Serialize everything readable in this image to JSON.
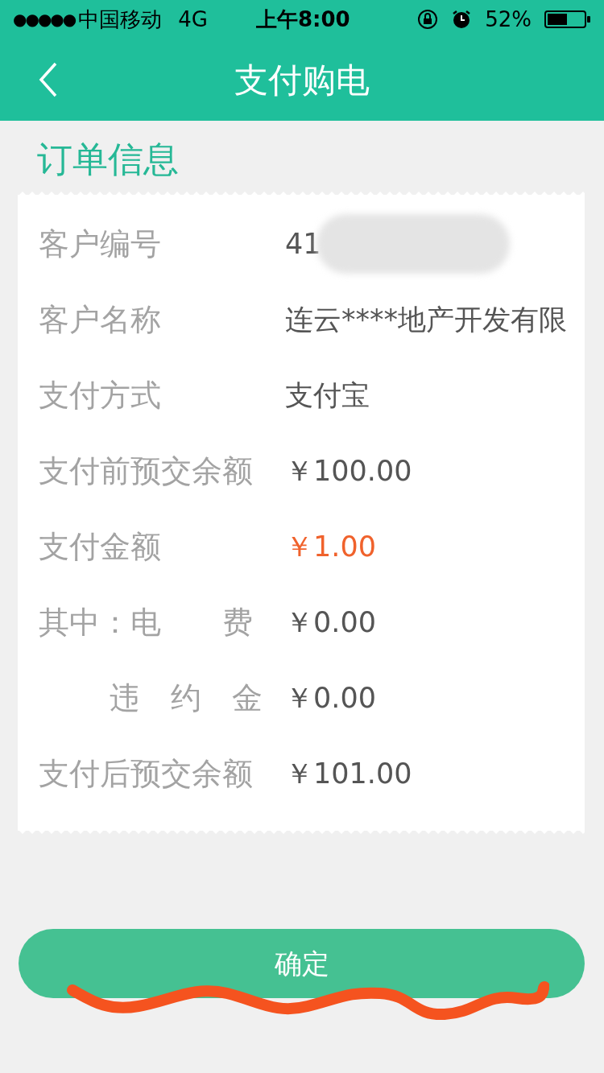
{
  "status_bar": {
    "signal": "●●●●●",
    "carrier": "中国移动",
    "network": "4G",
    "time": "上午8:00",
    "battery_percent": "52%"
  },
  "nav_bar": {
    "title": "支付购电"
  },
  "section_title": "订单信息",
  "rows": [
    {
      "kind": "main",
      "label": "客户编号",
      "value": "41",
      "redacted": true
    },
    {
      "kind": "main",
      "label": "客户名称",
      "value": "连云****地产开发有限"
    },
    {
      "kind": "main",
      "label": "支付方式",
      "value": "支付宝"
    },
    {
      "kind": "main",
      "label": "支付前预交余额",
      "value": "￥100.00"
    },
    {
      "kind": "main",
      "label": "支付金额",
      "value": "￥1.00",
      "highlight": true
    },
    {
      "kind": "main",
      "label": "其中：电　　费",
      "value": "￥0.00"
    },
    {
      "kind": "sub",
      "label": "违　约　金",
      "value": "￥0.00"
    },
    {
      "kind": "main",
      "label": "支付后预交余额",
      "value": "￥101.00"
    }
  ],
  "confirm_button": "确定"
}
